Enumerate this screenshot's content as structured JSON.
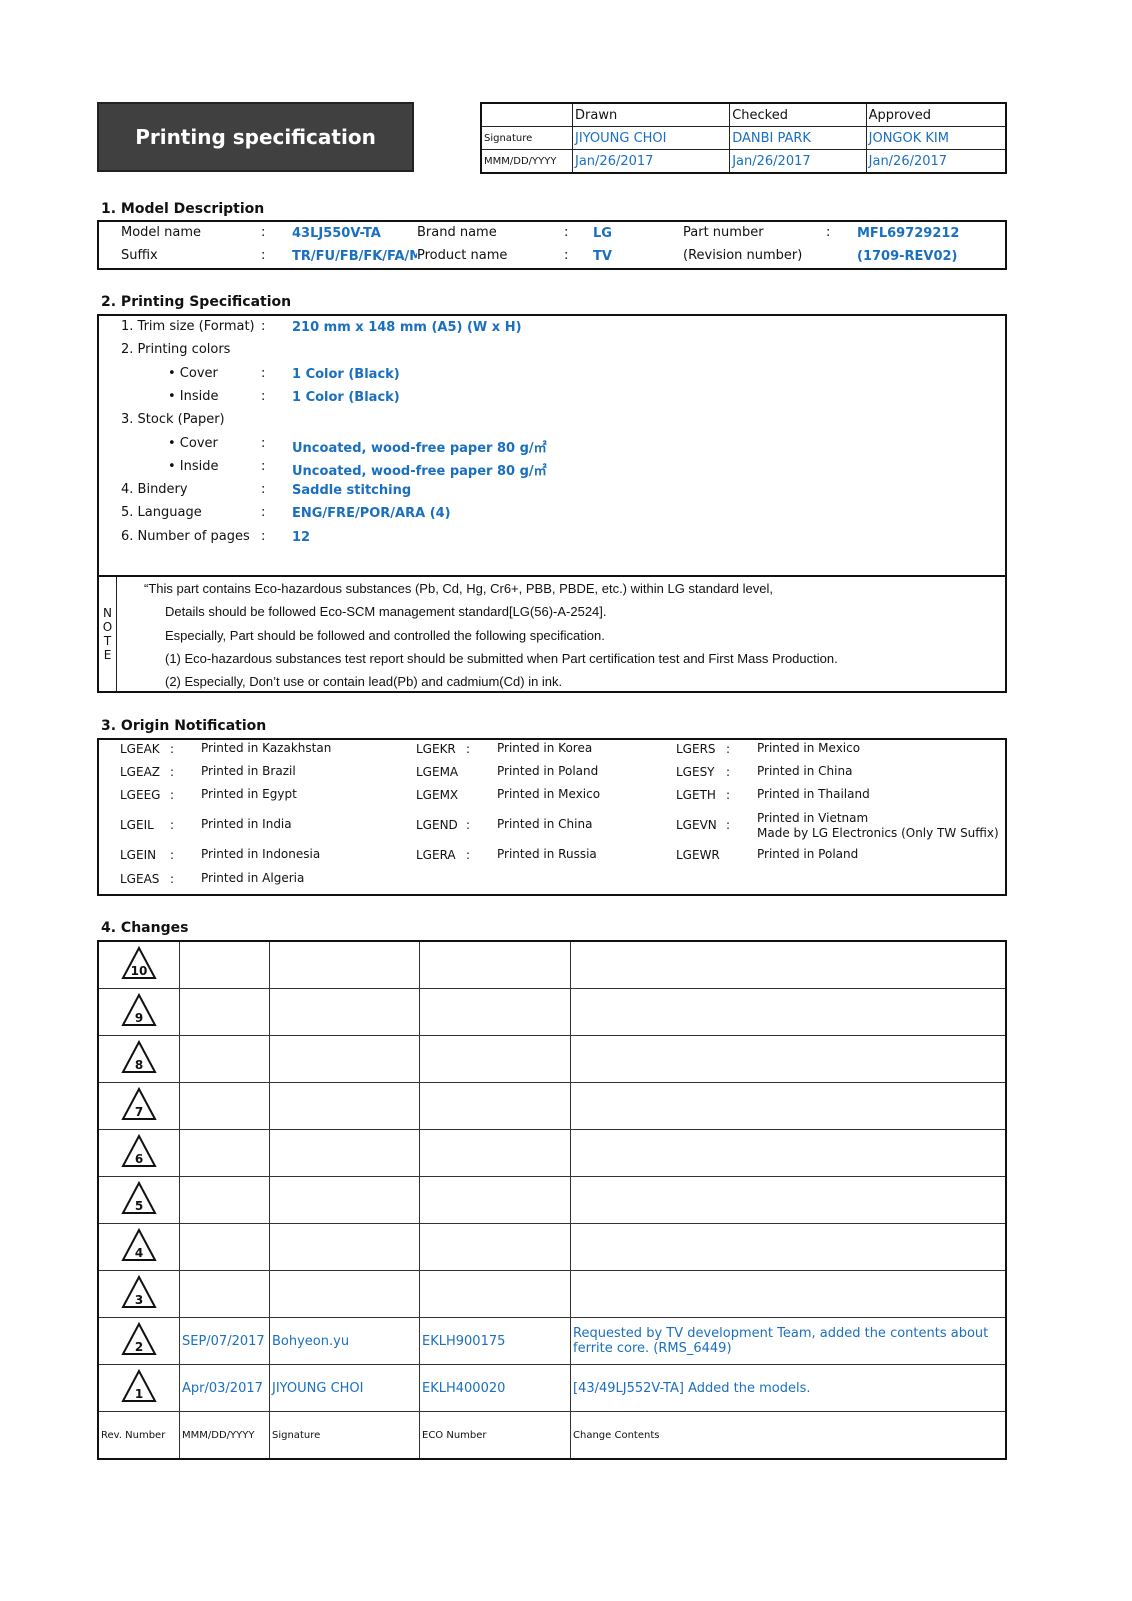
{
  "header": {
    "title": "Printing specification",
    "approval": {
      "columns": [
        "",
        "Drawn",
        "Checked",
        "Approved"
      ],
      "signature_label": "Signature",
      "date_label": "MMM/DD/YYYY",
      "signatures": [
        "JIYOUNG CHOI",
        "DANBI PARK",
        "JONGOK KIM"
      ],
      "dates": [
        "Jan/26/2017",
        "Jan/26/2017",
        "Jan/26/2017"
      ]
    }
  },
  "model": {
    "heading": "1. Model Description",
    "model_name_label": "Model name",
    "model_name": "43LJ550V-TA",
    "suffix_label": "Suffix",
    "suffix": "TR/FU/FB/FK/FA/M/",
    "brand_label": "Brand name",
    "brand": "LG",
    "product_label": "Product name",
    "product": "TV",
    "part_label": "Part number",
    "part": "MFL69729212",
    "revision_label": "(Revision number)",
    "revision": "(1709-REV02)",
    "colon": ":"
  },
  "spec": {
    "heading": "2. Printing Specification",
    "items": [
      {
        "label": "1. Trim size (Format)",
        "value": "210 mm x 148 mm (A5) (W x H)"
      },
      {
        "label": "2. Printing colors",
        "value": ""
      },
      {
        "label": "• Cover",
        "value": "1 Color (Black)"
      },
      {
        "label": "• Inside",
        "value": "1 Color (Black)"
      },
      {
        "label": "3. Stock (Paper)",
        "value": ""
      },
      {
        "label": "• Cover",
        "value": "Uncoated, wood-free paper 80 g/㎡"
      },
      {
        "label": "• Inside",
        "value": "Uncoated, wood-free paper 80 g/㎡"
      },
      {
        "label": "4. Bindery",
        "value": "Saddle stitching"
      },
      {
        "label": "5. Language",
        "value": "ENG/FRE/POR/ARA (4)"
      },
      {
        "label": "6. Number of pages",
        "value": "12"
      }
    ],
    "note_side": [
      "N",
      "O",
      "T",
      "E"
    ],
    "notes": [
      "“This part contains Eco-hazardous substances (Pb, Cd, Hg, Cr6+, PBB, PBDE, etc.) within LG standard level,",
      "Details should be followed Eco-SCM management standard[LG(56)-A-2524].",
      "Especially, Part should be followed and controlled the following specification.",
      "(1) Eco-hazardous substances test report should be submitted when Part certification test and First Mass Production.",
      "(2) Especially, Don’t use or contain lead(Pb) and cadmium(Cd) in ink."
    ]
  },
  "origin": {
    "heading": "3. Origin Notification",
    "columns": [
      [
        {
          "code": "LGEAK",
          "colon": ":",
          "text": "Printed in Kazakhstan"
        },
        {
          "code": "LGEAZ",
          "colon": ":",
          "text": "Printed in Brazil"
        },
        {
          "code": "LGEEG",
          "colon": ":",
          "text": "Printed in Egypt"
        },
        {
          "code": "LGEIL",
          "colon": ":",
          "text": "Printed in India"
        },
        {
          "code": "LGEIN",
          "colon": ":",
          "text": "Printed in Indonesia"
        },
        {
          "code": "LGEAS",
          "colon": ":",
          "text": "Printed in Algeria"
        }
      ],
      [
        {
          "code": "LGEKR",
          "colon": ":",
          "text": "Printed in Korea"
        },
        {
          "code": "LGEMA",
          "colon": "",
          "text": "Printed in Poland"
        },
        {
          "code": "LGEMX",
          "colon": "",
          "text": "Printed in Mexico"
        },
        {
          "code": "LGEND",
          "colon": ":",
          "text": "Printed in China"
        },
        {
          "code": "LGERA",
          "colon": ":",
          "text": "Printed in Russia"
        }
      ],
      [
        {
          "code": "LGERS",
          "colon": ":",
          "text": "Printed in Mexico"
        },
        {
          "code": "LGESY",
          "colon": ":",
          "text": "Printed in China"
        },
        {
          "code": "LGETH",
          "colon": ":",
          "text": "Printed in Thailand"
        },
        {
          "code": "LGEVN",
          "colon": ":",
          "text": "Printed in Vietnam",
          "text2": "Made by LG Electronics (Only TW Suffix)"
        },
        {
          "code": "LGEWR",
          "colon": "",
          "text": "Printed in Poland"
        }
      ]
    ]
  },
  "changes": {
    "heading": "4. Changes",
    "rows": [
      {
        "rev": "10",
        "date": "",
        "signature": "",
        "eco": "",
        "contents": ""
      },
      {
        "rev": "9",
        "date": "",
        "signature": "",
        "eco": "",
        "contents": ""
      },
      {
        "rev": "8",
        "date": "",
        "signature": "",
        "eco": "",
        "contents": ""
      },
      {
        "rev": "7",
        "date": "",
        "signature": "",
        "eco": "",
        "contents": ""
      },
      {
        "rev": "6",
        "date": "",
        "signature": "",
        "eco": "",
        "contents": ""
      },
      {
        "rev": "5",
        "date": "",
        "signature": "",
        "eco": "",
        "contents": ""
      },
      {
        "rev": "4",
        "date": "",
        "signature": "",
        "eco": "",
        "contents": ""
      },
      {
        "rev": "3",
        "date": "",
        "signature": "",
        "eco": "",
        "contents": ""
      },
      {
        "rev": "2",
        "date": "SEP/07/2017",
        "signature": "Bohyeon.yu",
        "eco": "EKLH900175",
        "contents": "Requested by TV development Team, added the contents about ferrite core. (RMS_6449)"
      },
      {
        "rev": "1",
        "date": "Apr/03/2017",
        "signature": "JIYOUNG CHOI",
        "eco": "EKLH400020",
        "contents": "[43/49LJ552V-TA] Added the models."
      }
    ],
    "footer": [
      "Rev. Number",
      "MMM/DD/YYYY",
      "Signature",
      "ECO Number",
      "Change Contents"
    ]
  },
  "colors": {
    "accent": "#1a6fbf",
    "title_bg": "#404040"
  }
}
